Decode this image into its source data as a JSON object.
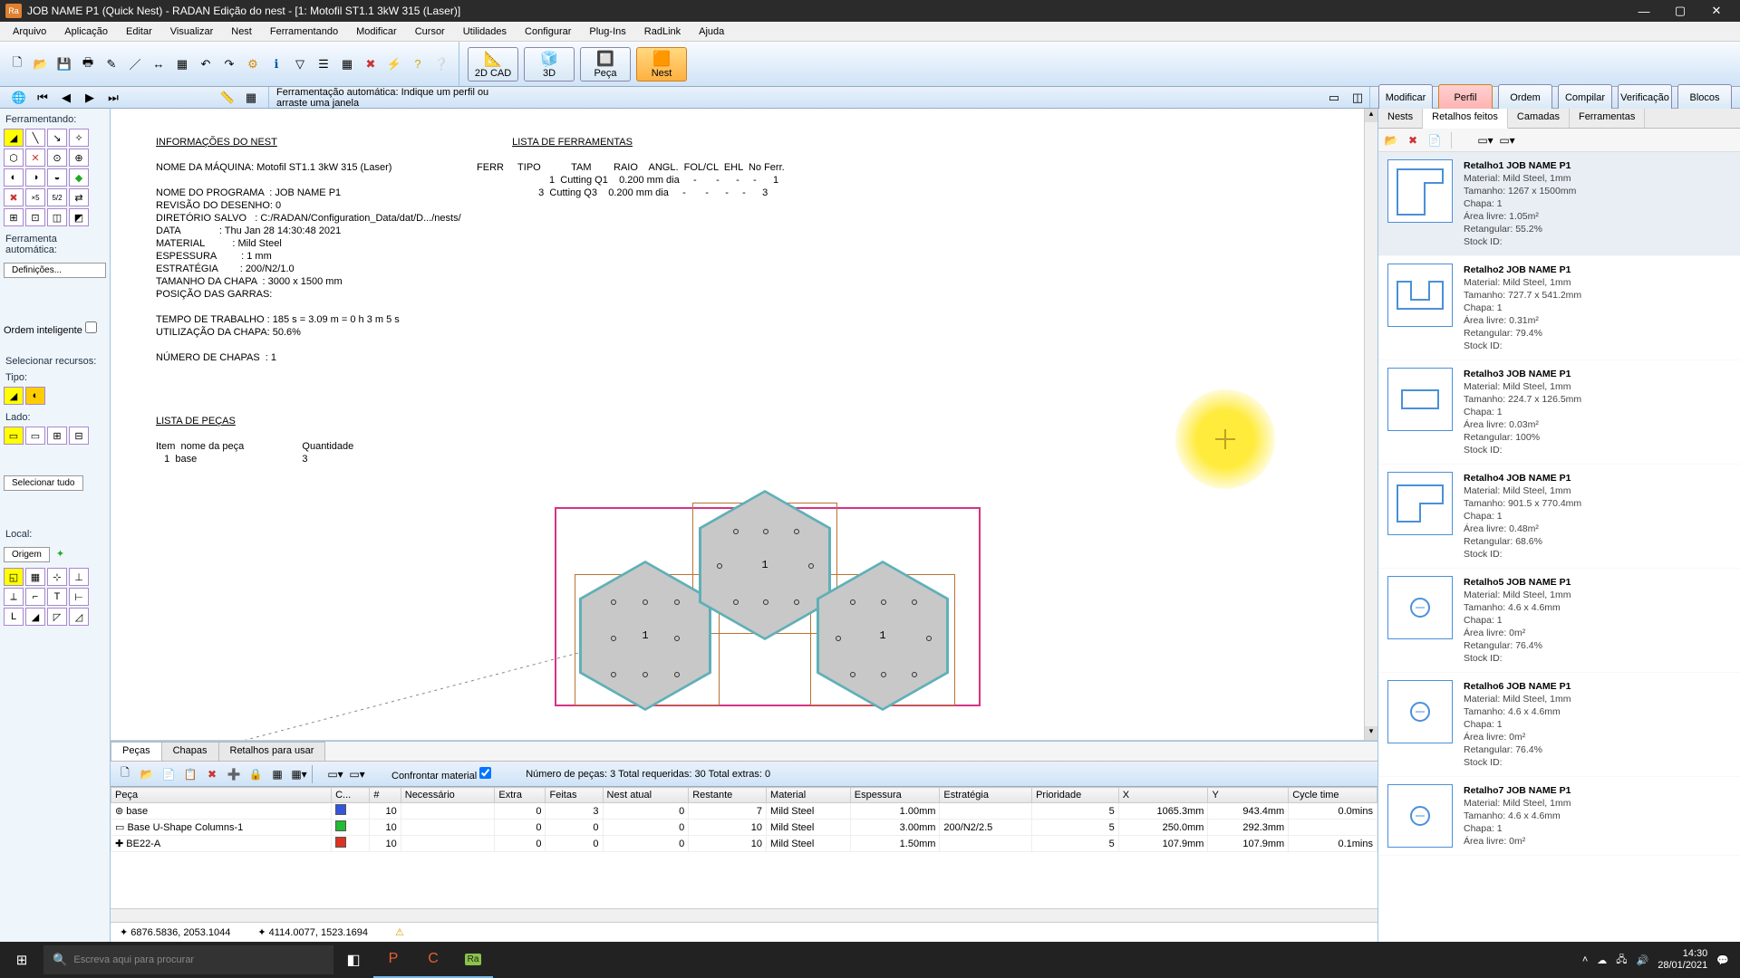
{
  "title": "JOB NAME P1 (Quick Nest) - RADAN Edição do nest - [1: Motofil ST1.1 3kW 315 (Laser)]",
  "menu": [
    "Arquivo",
    "Aplicação",
    "Editar",
    "Visualizar",
    "Nest",
    "Ferramentando",
    "Modificar",
    "Cursor",
    "Utilidades",
    "Configurar",
    "Plug-Ins",
    "RadLink",
    "Ajuda"
  ],
  "modes": {
    "a": "2D CAD",
    "b": "3D",
    "c": "Peça",
    "d": "Nest"
  },
  "subtabs": {
    "a": "Modificar",
    "b": "Perfil",
    "c": "Ordem",
    "d": "Compilar",
    "e": "Verificação",
    "f": "Blocos"
  },
  "row2msg": "Ferramentação automática: Indique um perfil ou arraste uma janela",
  "left": {
    "head1": "Ferramentando:",
    "autolbl": "Ferramenta automática:",
    "defs": "Definições...",
    "ordem": "Ordem inteligente",
    "selrec": "Selecionar recursos:",
    "tipo": "Tipo:",
    "lado": "Lado:",
    "seltudo": "Selecionar tudo",
    "local": "Local:",
    "origem": "Origem"
  },
  "report": {
    "h1": "INFORMAÇÕES DO NEST",
    "h2": "LISTA DE FERRAMENTAS",
    "l1": "NOME DA MÁQUINA: Motofil ST1.1 3kW 315 (Laser)",
    "l2": "NOME DO PROGRAMA  : JOB NAME P1",
    "l3": "REVISÃO DO DESENHO: 0",
    "l4": "DIRETÓRIO SALVO   : C:/RADAN/Configuration_Data/dat/D.../nests/",
    "l5": "DATA              : Thu Jan 28 14:30:48 2021",
    "l6": "MATERIAL          : Mild Steel",
    "l7": "ESPESSURA         : 1 mm",
    "l8": "ESTRATÉGIA        : 200/N2/1.0",
    "l9": "TAMANHO DA CHAPA  : 3000 x 1500 mm",
    "l10": "POSIÇÃO DAS GARRAS:",
    "l11": "TEMPO DE TRABALHO : 185 s = 3.09 m = 0 h 3 m 5 s",
    "l12": "UTILIZAÇÃO DA CHAPA: 50.6%",
    "l13": "NÚMERO DE CHAPAS  : 1",
    "fh": "FERR     TIPO           TAM        RAIO    ANGL.  FOL/CL  EHL  No Ferr.",
    "f1": "   1  Cutting Q1    0.200 mm dia     -       -      -     -      1",
    "f2": "   3  Cutting Q3    0.200 mm dia     -       -      -     -      3",
    "h3": "LISTA DE PEÇAS",
    "ph": "Item  nome da peça                     Quantidade",
    "p1": "   1  base                                      3"
  },
  "bottom": {
    "tabs": [
      "Peças",
      "Chapas",
      "Retalhos para usar"
    ],
    "confront": "Confrontar material",
    "stats": "Número de peças: 3   Total requeridas: 30   Total extras: 0",
    "cols": [
      "Peça",
      "C...",
      "#",
      "Necessário",
      "Extra",
      "Feitas",
      "Nest atual",
      "Restante",
      "Material",
      "Espessura",
      "Estratégia",
      "Prioridade",
      "X",
      "Y",
      "Cycle time"
    ],
    "rows": [
      {
        "n": "base",
        "c": "#3355dd",
        "q": "10",
        "nec": "0",
        "ext": "3",
        "fe": "0",
        "na": "7",
        "mat": "Mild Steel",
        "esp": "1.00mm",
        "est": "",
        "pr": "5",
        "x": "1065.3mm",
        "y": "943.4mm",
        "ct": "0.0mins",
        "ico": "⊚"
      },
      {
        "n": "Base U-Shape Columns-1",
        "c": "#22bb33",
        "q": "10",
        "nec": "0",
        "ext": "0",
        "fe": "0",
        "na": "10",
        "mat": "Mild Steel",
        "esp": "3.00mm",
        "est": "200/N2/2.5",
        "pr": "5",
        "x": "250.0mm",
        "y": "292.3mm",
        "ct": "",
        "ico": "▭"
      },
      {
        "n": "BE22-A",
        "c": "#dd3322",
        "q": "10",
        "nec": "0",
        "ext": "0",
        "fe": "0",
        "na": "10",
        "mat": "Mild Steel",
        "esp": "1.50mm",
        "est": "",
        "pr": "5",
        "x": "107.9mm",
        "y": "107.9mm",
        "ct": "0.1mins",
        "ico": "✚"
      }
    ]
  },
  "right": {
    "tabs": [
      "Nests",
      "Retalhos feitos",
      "Camadas",
      "Ferramentas"
    ],
    "items": [
      {
        "n": "Retalho1 JOB NAME P1",
        "m": "Material: Mild Steel, 1mm",
        "t": "Tamanho: 1267 x 1500mm",
        "c": "Chapa: 1",
        "a": "Área livre: 1.05m²",
        "r": "Retangular: 55.2%",
        "s": "Stock ID:",
        "sh": "L1"
      },
      {
        "n": "Retalho2 JOB NAME P1",
        "m": "Material: Mild Steel, 1mm",
        "t": "Tamanho: 727.7 x 541.2mm",
        "c": "Chapa: 1",
        "a": "Área livre: 0.31m²",
        "r": "Retangular: 79.4%",
        "s": "Stock ID:",
        "sh": "T"
      },
      {
        "n": "Retalho3 JOB NAME P1",
        "m": "Material: Mild Steel, 1mm",
        "t": "Tamanho: 224.7 x 126.5mm",
        "c": "Chapa: 1",
        "a": "Área livre: 0.03m²",
        "r": "Retangular: 100%",
        "s": "Stock ID:",
        "sh": "R"
      },
      {
        "n": "Retalho4 JOB NAME P1",
        "m": "Material: Mild Steel, 1mm",
        "t": "Tamanho: 901.5 x 770.4mm",
        "c": "Chapa: 1",
        "a": "Área livre: 0.48m²",
        "r": "Retangular: 68.6%",
        "s": "Stock ID:",
        "sh": "L2"
      },
      {
        "n": "Retalho5 JOB NAME P1",
        "m": "Material: Mild Steel, 1mm",
        "t": "Tamanho: 4.6 x 4.6mm",
        "c": "Chapa: 1",
        "a": "Área livre: 0m²",
        "r": "Retangular: 76.4%",
        "s": "Stock ID:",
        "sh": "C"
      },
      {
        "n": "Retalho6 JOB NAME P1",
        "m": "Material: Mild Steel, 1mm",
        "t": "Tamanho: 4.6 x 4.6mm",
        "c": "Chapa: 1",
        "a": "Área livre: 0m²",
        "r": "Retangular: 76.4%",
        "s": "Stock ID:",
        "sh": "C"
      },
      {
        "n": "Retalho7 JOB NAME P1",
        "m": "Material: Mild Steel, 1mm",
        "t": "Tamanho: 4.6 x 4.6mm",
        "c": "Chapa: 1",
        "a": "Área livre: 0m²",
        "r": "",
        "s": "",
        "sh": "C"
      }
    ]
  },
  "status": {
    "c1": "6876.5836, 2053.1044",
    "c2": "4114.0077, 1523.1694"
  },
  "task": {
    "search": "Escreva aqui para procurar",
    "time": "14:30",
    "date": "28/01/2021"
  }
}
